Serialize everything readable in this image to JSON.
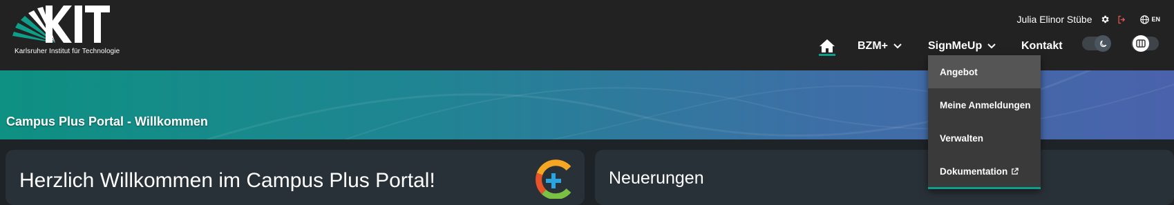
{
  "header": {
    "logo_text": "KIT",
    "logo_subtitle": "Karlsruher Institut für Technologie",
    "user_name": "Julia Elinor Stübe",
    "language": "EN",
    "icons": [
      "settings-icon",
      "logout-icon",
      "globe-icon",
      "home-icon",
      "moon-icon",
      "columns-icon"
    ],
    "accent_color": "#0f9e8a",
    "logout_color": "#e05a4f"
  },
  "nav": {
    "items": [
      {
        "label": "BZM+"
      },
      {
        "label": "SignMeUp"
      },
      {
        "label": "Kontakt"
      }
    ]
  },
  "dropdown": {
    "items": [
      {
        "label": "Angebot"
      },
      {
        "label": "Meine Anmeldungen"
      },
      {
        "label": "Verwalten"
      },
      {
        "label": "Dokumentation"
      }
    ],
    "active_index": 0
  },
  "banner": {
    "title": "Campus Plus Portal - Willkommen"
  },
  "cards": {
    "welcome_title": "Herzlich Willkommen im Campus Plus Portal!",
    "news_title": "Neuerungen"
  }
}
